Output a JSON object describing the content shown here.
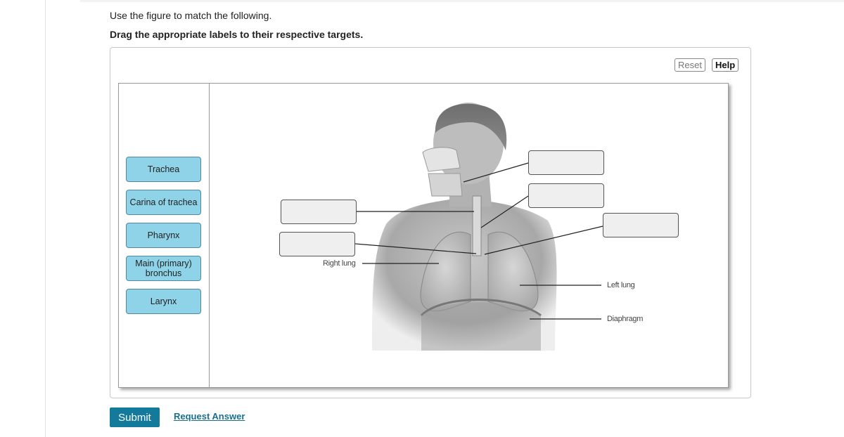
{
  "instructions": {
    "line1": "Use the figure to match the following.",
    "line2": "Drag the appropriate labels to their respective targets."
  },
  "toolbar": {
    "reset_label": "Reset",
    "help_label": "Help"
  },
  "label_bank": [
    {
      "text": "Trachea"
    },
    {
      "text": "Carina of trachea"
    },
    {
      "text": "Pharynx"
    },
    {
      "text": "Main (primary) bronchus"
    },
    {
      "text": "Larynx"
    }
  ],
  "figure": {
    "image": "human-respiratory-system-illustration",
    "drop_targets": [
      {
        "id": "target-1",
        "value": ""
      },
      {
        "id": "target-2",
        "value": ""
      },
      {
        "id": "target-3",
        "value": ""
      },
      {
        "id": "target-4",
        "value": ""
      },
      {
        "id": "target-5",
        "value": ""
      }
    ],
    "fixed_labels": {
      "right_lung": "Right lung",
      "left_lung": "Left lung",
      "diaphragm": "Diaphragm"
    }
  },
  "actions": {
    "submit_label": "Submit",
    "request_answer_label": "Request Answer"
  }
}
